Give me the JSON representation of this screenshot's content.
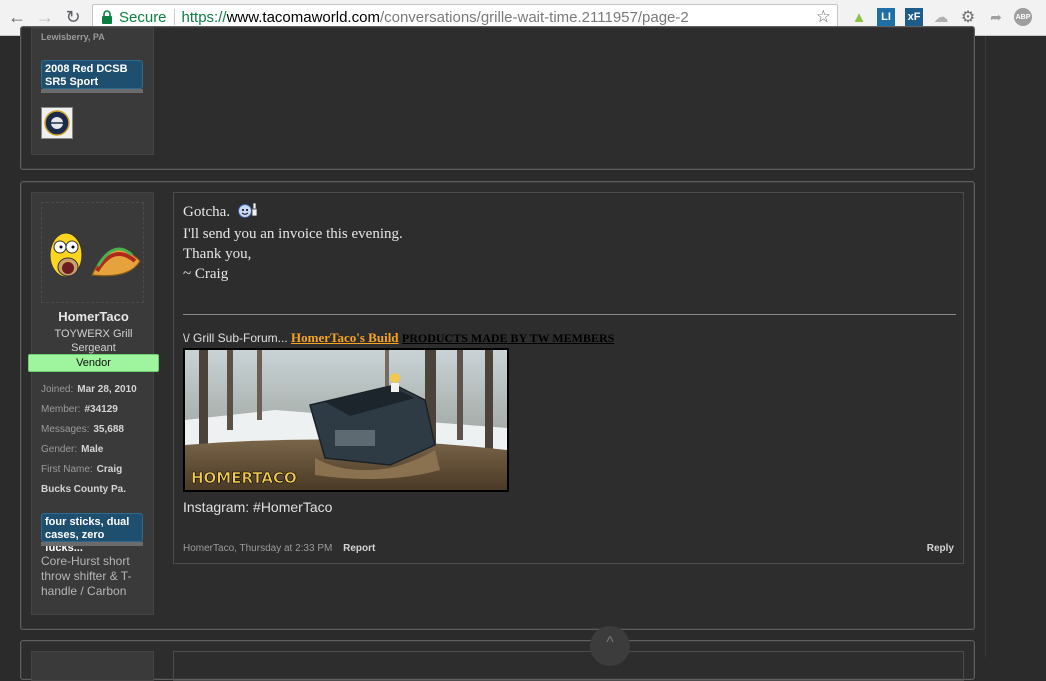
{
  "browser": {
    "secure_label": "Secure",
    "url_scheme": "https://",
    "url_host": "www.tacomaworld.com",
    "url_path": "/conversations/grille-wait-time.2111957/page-2",
    "ext_li": "LI",
    "ext_xf": "xF",
    "ext_abp": "ABP"
  },
  "prev_post": {
    "location": "Lewisberry, PA",
    "truck": "2008 Red DCSB SR5 Sport"
  },
  "post": {
    "username": "HomerTaco",
    "title_line1": "TOYWERX Grill",
    "title_line2": "Sergeant",
    "vendor_label": "Vendor",
    "info": [
      {
        "label": "Joined:",
        "value": "Mar 28, 2010"
      },
      {
        "label": "Member:",
        "value": "#34129"
      },
      {
        "label": "Messages:",
        "value": "35,688"
      },
      {
        "label": "Gender:",
        "value": "Male"
      },
      {
        "label": "First Name:",
        "value": "Craig"
      }
    ],
    "location": "Bucks County Pa.",
    "truck": "four sticks, dual cases, zero fucks...",
    "custom_text": "Core-Hurst short throw shifter & T-handle / Carbon",
    "message_lines": [
      "Gotcha.",
      "I'll send you an invoice this evening.",
      "Thank you,",
      "~ Craig"
    ],
    "sig_prefix": "\\/ Grill Sub-Forum...",
    "sig_link": "HomerTaco's Build",
    "sig_products": "PRODUCTS MADE BY TW MEMBERS",
    "sig_image_caption": "HOMERTACO",
    "instagram": "Instagram: #HomerTaco",
    "footer_author": "HomerTaco,",
    "footer_time": "Thursday at 2:33 PM",
    "report_label": "Report",
    "reply_label": "Reply"
  },
  "colors": {
    "vendor_bg": "#9ef59e",
    "badge_blue": "#1f4f6f",
    "link_orange": "#f7a521",
    "secure_green": "#0b8043"
  }
}
